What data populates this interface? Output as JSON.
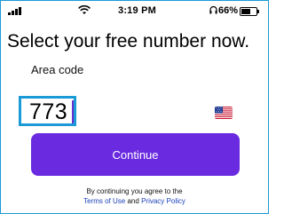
{
  "status_bar": {
    "time": "3:19 PM",
    "battery": "66%"
  },
  "headline": "Select your free number now.",
  "area_code": {
    "label": "Area code",
    "value": "773",
    "flag_icon": "us-flag-icon"
  },
  "continue_button": "Continue",
  "legal": {
    "prefix": "By continuing you agree to the",
    "terms_link": "Terms of Use",
    "conjunction": "and",
    "privacy_link": "Privacy Policy"
  },
  "colors": {
    "accent": "#6a2be0",
    "focus_border": "#1a9ad6",
    "link": "#1a3fb8"
  }
}
